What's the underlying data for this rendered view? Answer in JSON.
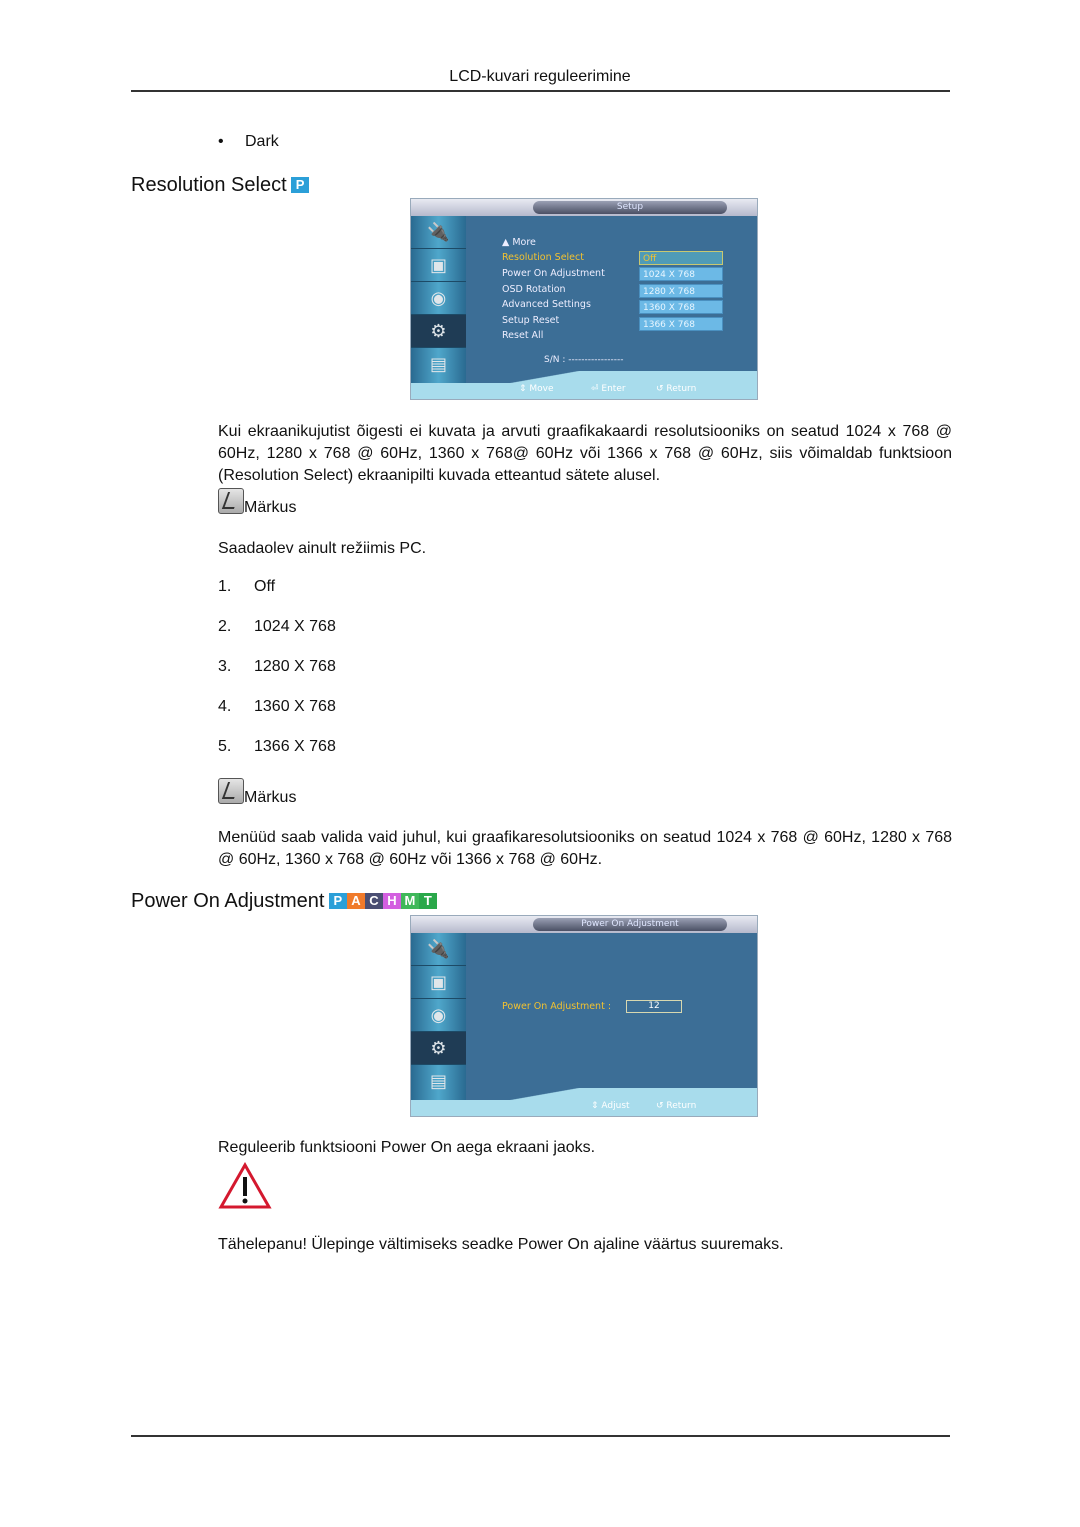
{
  "header": {
    "title": "LCD-kuvari reguleerimine"
  },
  "bullet": {
    "text": "Dark"
  },
  "resolution_section": {
    "title": "Resolution Select",
    "badges": [
      {
        "letter": "P",
        "color": "#2b9fd8"
      }
    ],
    "osd": {
      "title": "Setup",
      "more_label": "▲ More",
      "menu_items": [
        "Resolution Select",
        "Power On Adjustment",
        "OSD Rotation",
        "Advanced Settings",
        "Setup Reset",
        "Reset All"
      ],
      "selected_item": "Resolution Select",
      "dropdown_options": [
        "Off",
        "1024 X 768",
        "1280 X 768",
        "1360 X 768",
        "1366 X 768"
      ],
      "dropdown_selected": "Off",
      "sn_label": "S/N : -----------------",
      "hints": {
        "move": "Move",
        "enter": "Enter",
        "return": "Return"
      }
    },
    "paragraph": {
      "p1": "Kui ekraanikujutist õigesti ei kuvata ja arvuti graafikakaardi resolutsiooniks on seatud ",
      "b1": "1024 x 768 @ 60Hz",
      "p2": ", ",
      "b2": "1280 x 768 @ 60Hz",
      "p3": ", ",
      "b3": "1360 x 768@ 60Hz",
      "p4": " või ",
      "b4": "1366 x 768 @ 60Hz",
      "p5": ", siis võimaldab funktsioon (Resolution Select) ekraanipilti kuvada etteantud sätete alusel."
    },
    "note1": {
      "label": "Märkus",
      "text_pre": "Saadaolev ainult režiimis ",
      "text_bold": "PC",
      "text_post": "."
    },
    "options": [
      {
        "num": "1.",
        "label": "Off"
      },
      {
        "num": "2.",
        "label": "1024 X 768"
      },
      {
        "num": "3.",
        "label": "1280 X 768"
      },
      {
        "num": "4.",
        "label": "1360 X 768"
      },
      {
        "num": "5.",
        "label": "1366 X 768"
      }
    ],
    "note2": {
      "label": "Märkus",
      "p1": "Menüüd saab valida vaid juhul, kui graafikaresolutsiooniks on seatud ",
      "b1": "1024 x 768 @ 60Hz",
      "p2": ", ",
      "b2": "1280 x 768 @ 60Hz",
      "p3": ", ",
      "b3": "1360 x 768 @ 60Hz",
      "p4": " või ",
      "b4": "1366 x 768 @ 60Hz",
      "p5": "."
    }
  },
  "power_section": {
    "title": "Power On Adjustment",
    "badges": [
      {
        "letter": "P",
        "color": "#2b9fd8"
      },
      {
        "letter": "A",
        "color": "#f07a2a"
      },
      {
        "letter": "C",
        "color": "#4a4e73"
      },
      {
        "letter": "H",
        "color": "#d35fe0"
      },
      {
        "letter": "M",
        "color": "#3fb85a"
      },
      {
        "letter": "T",
        "color": "#2aa84a"
      }
    ],
    "osd": {
      "title": "Power On Adjustment",
      "field_label": "Power On Adjustment :",
      "field_value": "12",
      "hints": {
        "adjust": "Adjust",
        "return": "Return"
      }
    },
    "description": "Reguleerib funktsiooni Power On aega ekraani jaoks.",
    "warning": "Tähelepanu! Ülepinge vältimiseks seadke Power On ajaline väärtus suuremaks."
  }
}
